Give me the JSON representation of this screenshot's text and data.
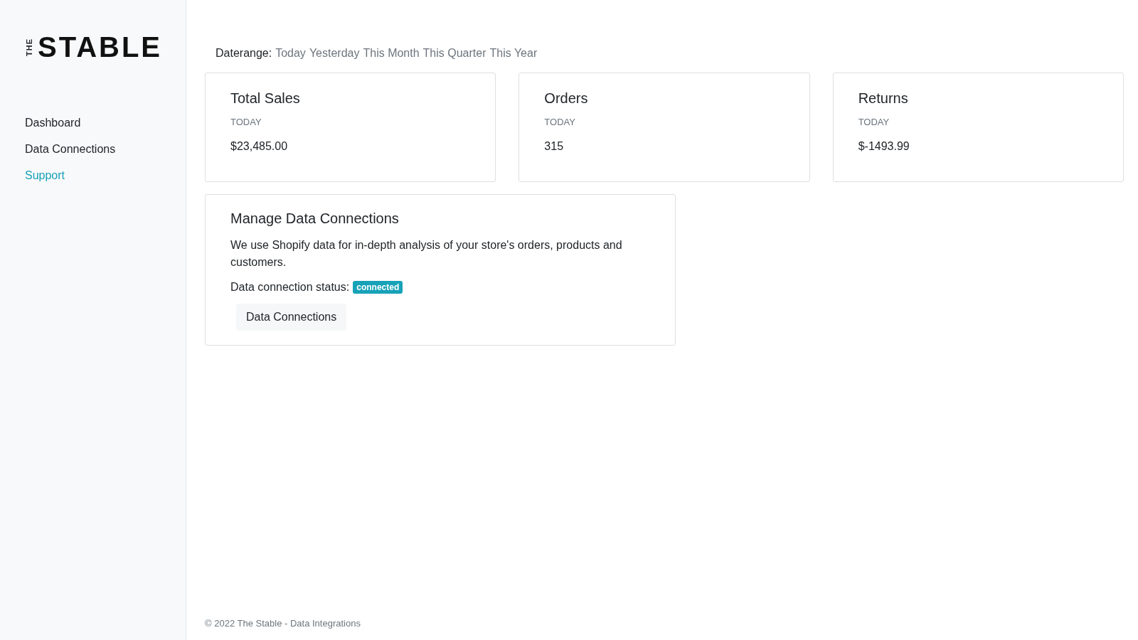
{
  "sidebar": {
    "logo": {
      "small": "THE",
      "main": "STABLE"
    },
    "items": [
      {
        "label": "Dashboard",
        "selected": false
      },
      {
        "label": "Data Connections",
        "selected": false
      },
      {
        "label": "Support",
        "selected": true
      }
    ]
  },
  "daterange": {
    "label": "Daterange:",
    "options": [
      "Today",
      "Yesterday",
      "This Month",
      "This Quarter",
      "This Year"
    ]
  },
  "stats": [
    {
      "title": "Total Sales",
      "period": "TODAY",
      "value": "$23,485.00"
    },
    {
      "title": "Orders",
      "period": "TODAY",
      "value": "315"
    },
    {
      "title": "Returns",
      "period": "TODAY",
      "value": "$-1493.99"
    }
  ],
  "connections": {
    "title": "Manage Data Connections",
    "description": "We use Shopify data for in-depth analysis of your store's orders, products and customers.",
    "status_label": "Data connection status:",
    "status": "connected",
    "button": "Data Connections"
  },
  "footer": "© 2022 The Stable - Data Integrations"
}
